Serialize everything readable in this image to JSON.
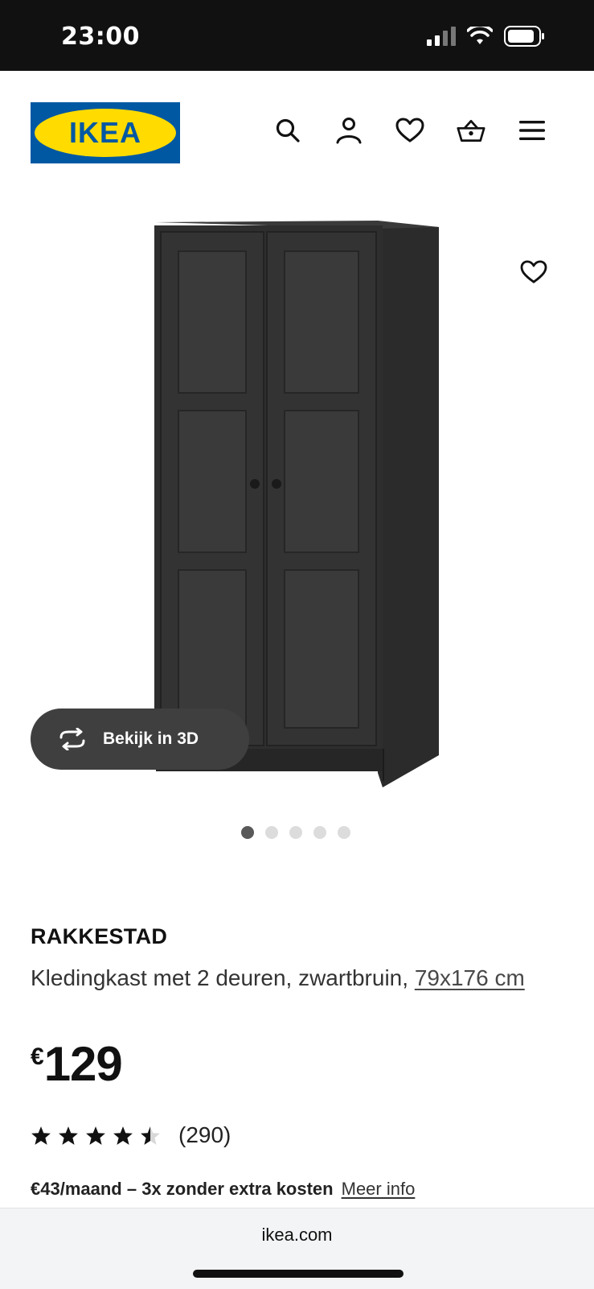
{
  "status_bar": {
    "time": "23:00"
  },
  "header": {
    "logo_text": "IKEA",
    "icons": [
      "search-icon",
      "account-icon",
      "wishlist-icon",
      "cart-icon",
      "menu-icon"
    ]
  },
  "gallery": {
    "view3d_label": "Bekijk in 3D",
    "slide_count": 5,
    "active_slide": 1
  },
  "product": {
    "name": "RAKKESTAD",
    "description": "Kledingkast met 2 deuren, zwartbruin, ",
    "size_link": "79x176 cm",
    "currency": "€",
    "price": "129",
    "rating": 4.5,
    "rating_count": "(290)",
    "installment_text": "€43/maand – 3x zonder extra kosten",
    "installment_link": "Meer info"
  },
  "browser": {
    "url": "ikea.com"
  },
  "colors": {
    "ikea_blue": "#0058a3",
    "ikea_yellow": "#ffdb00",
    "status_bar": "#111111"
  }
}
